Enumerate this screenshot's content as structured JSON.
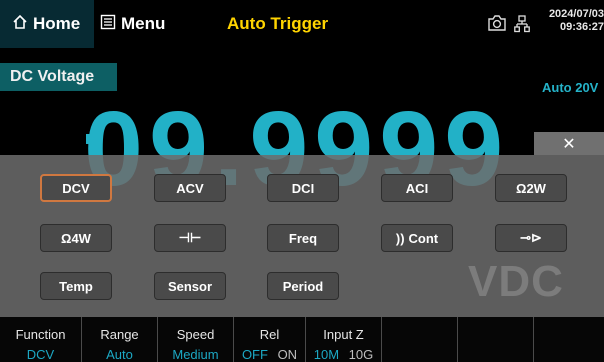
{
  "header": {
    "home_label": "Home",
    "menu_label": "Menu",
    "title": "Auto Trigger",
    "date": "2024/07/03",
    "time": "09:36:27"
  },
  "measurement": {
    "function_name": "DC Voltage",
    "range_indicator": "Auto 20V",
    "reading": "09.9999",
    "unit": "VDC"
  },
  "close_symbol": "✕",
  "function_buttons": [
    "DCV",
    "ACV",
    "DCI",
    "ACI",
    "Ω2W",
    "Ω4W",
    "⊣⊢",
    "Freq",
    "Cont",
    "⊸⊳",
    "Temp",
    "Sensor",
    "Period"
  ],
  "cont_icon": "))",
  "bottom": {
    "function": {
      "label": "Function",
      "value": "DCV"
    },
    "range": {
      "label": "Range",
      "value": "Auto"
    },
    "speed": {
      "label": "Speed",
      "value": "Medium"
    },
    "rel": {
      "label": "Rel",
      "off": "OFF",
      "on": "ON"
    },
    "inputz": {
      "label": "Input Z",
      "opt1": "10M",
      "opt2": "10G"
    }
  },
  "icons": {
    "home": "home-icon",
    "menu": "menu-icon",
    "camera": "camera-icon",
    "network": "network-icon"
  },
  "colors": {
    "accent": "#22b1c7",
    "title": "#ffd400",
    "selected_border": "#d07840"
  }
}
